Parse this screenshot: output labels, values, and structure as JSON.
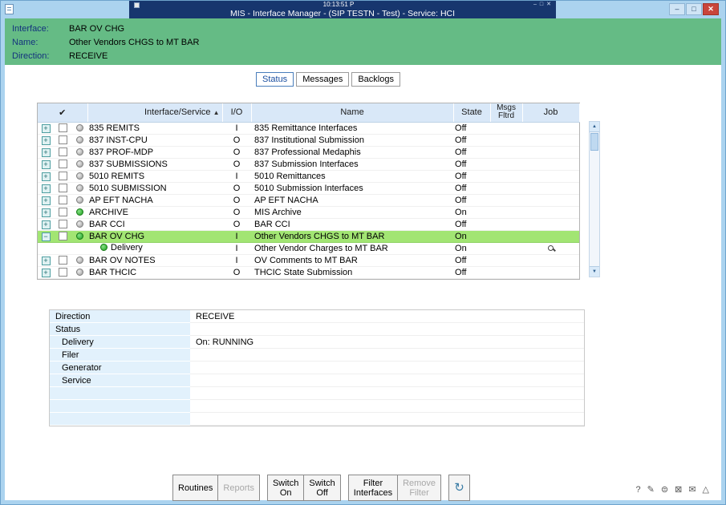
{
  "background_window": {
    "time": "10:13:51 P",
    "controls": [
      "–",
      "□",
      "✕"
    ]
  },
  "window": {
    "title": "MIS - Interface Manager - (SIP TESTN - Test) - Service: HCI",
    "controls": {
      "minimize": "–",
      "maximize": "□",
      "close": "✕"
    }
  },
  "interface_header": {
    "fields": [
      {
        "label": "Interface:",
        "value": "BAR OV CHG"
      },
      {
        "label": "Name:",
        "value": "Other Vendors CHGS to MT BAR"
      },
      {
        "label": "Direction:",
        "value": "RECEIVE"
      }
    ]
  },
  "tabs": [
    {
      "label": "Status",
      "active": true
    },
    {
      "label": "Messages",
      "active": false
    },
    {
      "label": "Backlogs",
      "active": false
    }
  ],
  "interface_table": {
    "expand_glyphs": {
      "plus": "+",
      "minus": "−"
    },
    "headers": {
      "check": "✔",
      "service": "Interface/Service",
      "sort_indicator": "▲",
      "io": "I/O",
      "name": "Name",
      "state": "State",
      "msgs": [
        "Msgs",
        "Fltrd"
      ],
      "job": "Job"
    },
    "rows": [
      {
        "expand": "plus",
        "checkbox": true,
        "led": "off",
        "service": "835 REMITS",
        "io": "I",
        "name": "835 Remittance Interfaces",
        "state": "Off"
      },
      {
        "expand": "plus",
        "checkbox": true,
        "led": "off",
        "service": "837 INST-CPU",
        "io": "O",
        "name": "837 Institutional Submission",
        "state": "Off"
      },
      {
        "expand": "plus",
        "checkbox": true,
        "led": "off",
        "service": "837 PROF-MDP",
        "io": "O",
        "name": "837 Professional Medaphis",
        "state": "Off"
      },
      {
        "expand": "plus",
        "checkbox": true,
        "led": "off",
        "service": "837 SUBMISSIONS",
        "io": "O",
        "name": "837 Submission Interfaces",
        "state": "Off"
      },
      {
        "expand": "plus",
        "checkbox": true,
        "led": "off",
        "service": "5010 REMITS",
        "io": "I",
        "name": "5010 Remittances",
        "state": "Off"
      },
      {
        "expand": "plus",
        "checkbox": true,
        "led": "off",
        "service": "5010 SUBMISSION",
        "io": "O",
        "name": "5010 Submission Interfaces",
        "state": "Off"
      },
      {
        "expand": "plus",
        "checkbox": true,
        "led": "off",
        "service": "AP EFT NACHA",
        "io": "O",
        "name": "AP EFT NACHA",
        "state": "Off"
      },
      {
        "expand": "plus",
        "checkbox": true,
        "led": "on",
        "service": "ARCHIVE",
        "io": "O",
        "name": "MIS Archive",
        "state": "On"
      },
      {
        "expand": "plus",
        "checkbox": true,
        "led": "off",
        "service": "BAR CCI",
        "io": "O",
        "name": "BAR CCI",
        "state": "Off"
      },
      {
        "expand": "minus",
        "checkbox": true,
        "led": "on",
        "service": "BAR OV CHG",
        "io": "I",
        "name": "Other Vendors CHGS to MT BAR",
        "state": "On",
        "selected": true
      },
      {
        "child": true,
        "led": "on",
        "service": "Delivery",
        "io": "I",
        "name": "Other Vendor Charges to MT BAR",
        "state": "On",
        "job": "magnifier"
      },
      {
        "expand": "plus",
        "checkbox": true,
        "led": "off",
        "service": "BAR OV NOTES",
        "io": "I",
        "name": "OV Comments to MT BAR",
        "state": "Off"
      },
      {
        "expand": "plus",
        "checkbox": true,
        "led": "off",
        "service": "BAR THCIC",
        "io": "O",
        "name": "THCIC State Submission",
        "state": "Off"
      }
    ]
  },
  "scrollbar": {
    "up": "▲",
    "down": "▼"
  },
  "details": {
    "rows": [
      {
        "label": "Direction",
        "value": "RECEIVE",
        "indent": false
      },
      {
        "label": "Status",
        "value": "",
        "indent": false
      },
      {
        "label": "Delivery",
        "value": "On: RUNNING",
        "indent": true
      },
      {
        "label": "Filer",
        "value": "",
        "indent": true
      },
      {
        "label": "Generator",
        "value": "",
        "indent": true
      },
      {
        "label": "Service",
        "value": "",
        "indent": true
      },
      {
        "label": "",
        "value": "",
        "indent": false
      },
      {
        "label": "",
        "value": "",
        "indent": false
      },
      {
        "label": "",
        "value": "",
        "indent": false
      }
    ]
  },
  "toolbar": {
    "buttons": [
      {
        "id": "routines",
        "lines": [
          "Routines"
        ],
        "enabled": true
      },
      {
        "id": "reports",
        "lines": [
          "Reports"
        ],
        "enabled": false
      },
      {
        "id": "switch-on",
        "lines": [
          "Switch",
          "On"
        ],
        "enabled": true
      },
      {
        "id": "switch-off",
        "lines": [
          "Switch",
          "Off"
        ],
        "enabled": true
      },
      {
        "id": "filter-interfaces",
        "lines": [
          "Filter",
          "Interfaces"
        ],
        "enabled": true
      },
      {
        "id": "remove-filter",
        "lines": [
          "Remove",
          "Filter"
        ],
        "enabled": false
      },
      {
        "id": "refresh",
        "lines": [
          "↻"
        ],
        "enabled": true,
        "icon": true
      }
    ]
  },
  "status_icons": [
    {
      "name": "help-icon",
      "glyph": "?"
    },
    {
      "name": "edit-icon",
      "glyph": "✎"
    },
    {
      "name": "print-icon",
      "glyph": "⊜"
    },
    {
      "name": "lock-icon",
      "glyph": "⊠"
    },
    {
      "name": "mail-icon",
      "glyph": "✉"
    },
    {
      "name": "warning-icon",
      "glyph": "△"
    }
  ],
  "colors": {
    "frame": "#abd3ef",
    "titlebar": "#17366e",
    "header_green": "#65bb85",
    "selected_row": "#a2e573",
    "led_on": "#2eaf2e",
    "close_button": "#c9453b"
  }
}
